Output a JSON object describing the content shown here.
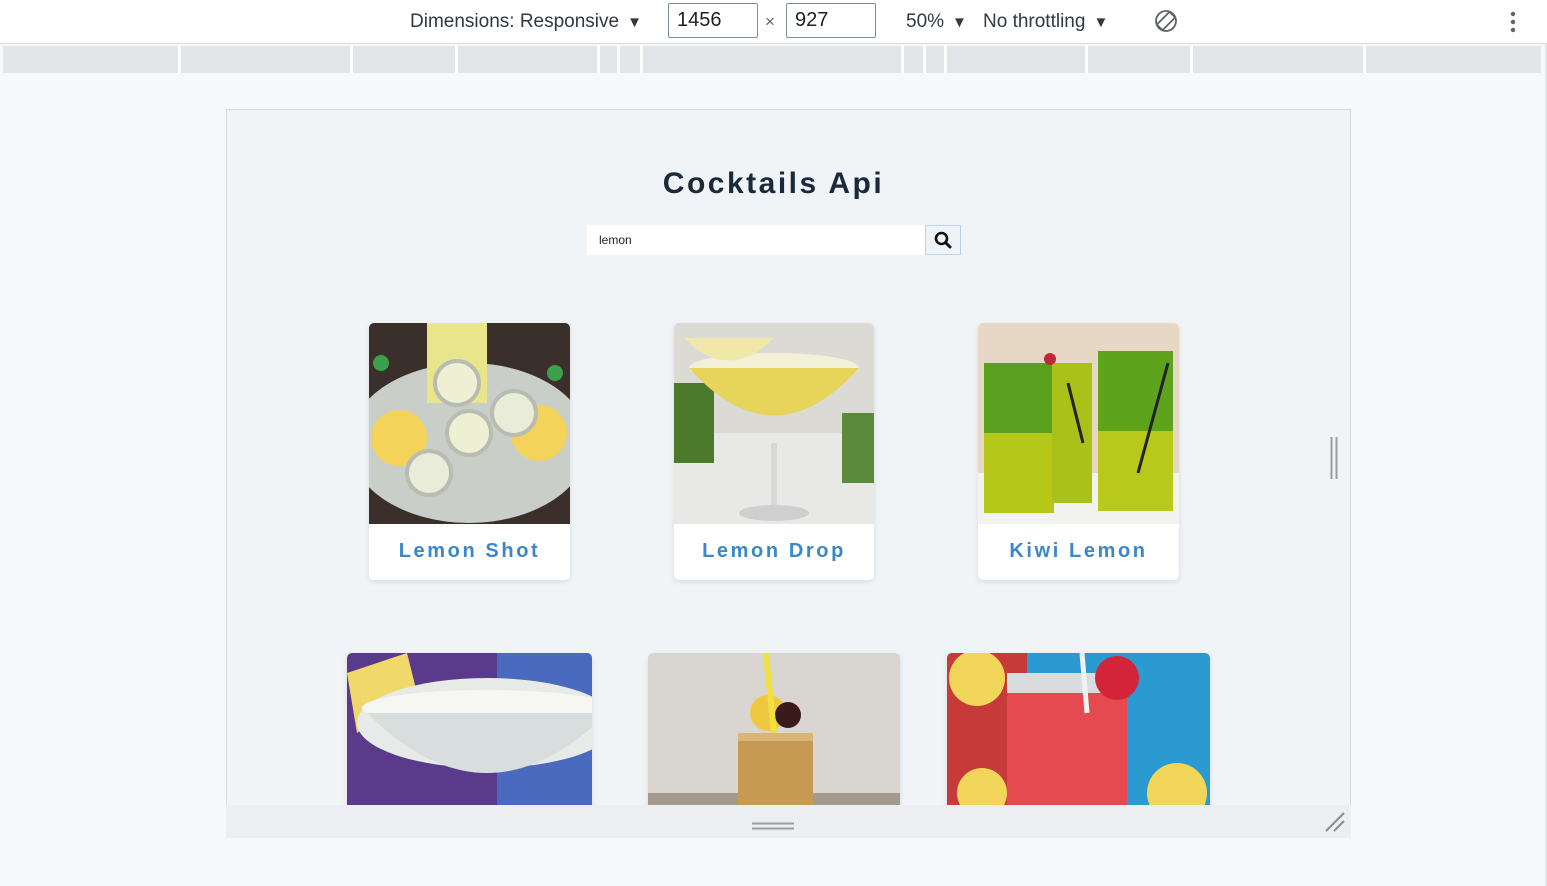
{
  "devtools": {
    "dimensions_label": "Dimensions: Responsive",
    "width_value": "1456",
    "height_value": "927",
    "times_sign": "×",
    "zoom_label": "50%",
    "throttling_label": "No throttling",
    "caret": "▼",
    "rotate_icon": "rotate-icon",
    "more_icon": "more-vert-icon"
  },
  "app": {
    "title": "Cocktails Api",
    "search": {
      "value": "lemon",
      "icon": "search-icon"
    },
    "accent_color": "#3a87c9",
    "title_color": "#1a2a3a",
    "drinks": [
      {
        "name": "Lemon Shot"
      },
      {
        "name": "Lemon Drop"
      },
      {
        "name": "Kiwi Lemon"
      },
      {
        "name": ""
      },
      {
        "name": ""
      },
      {
        "name": ""
      }
    ]
  }
}
